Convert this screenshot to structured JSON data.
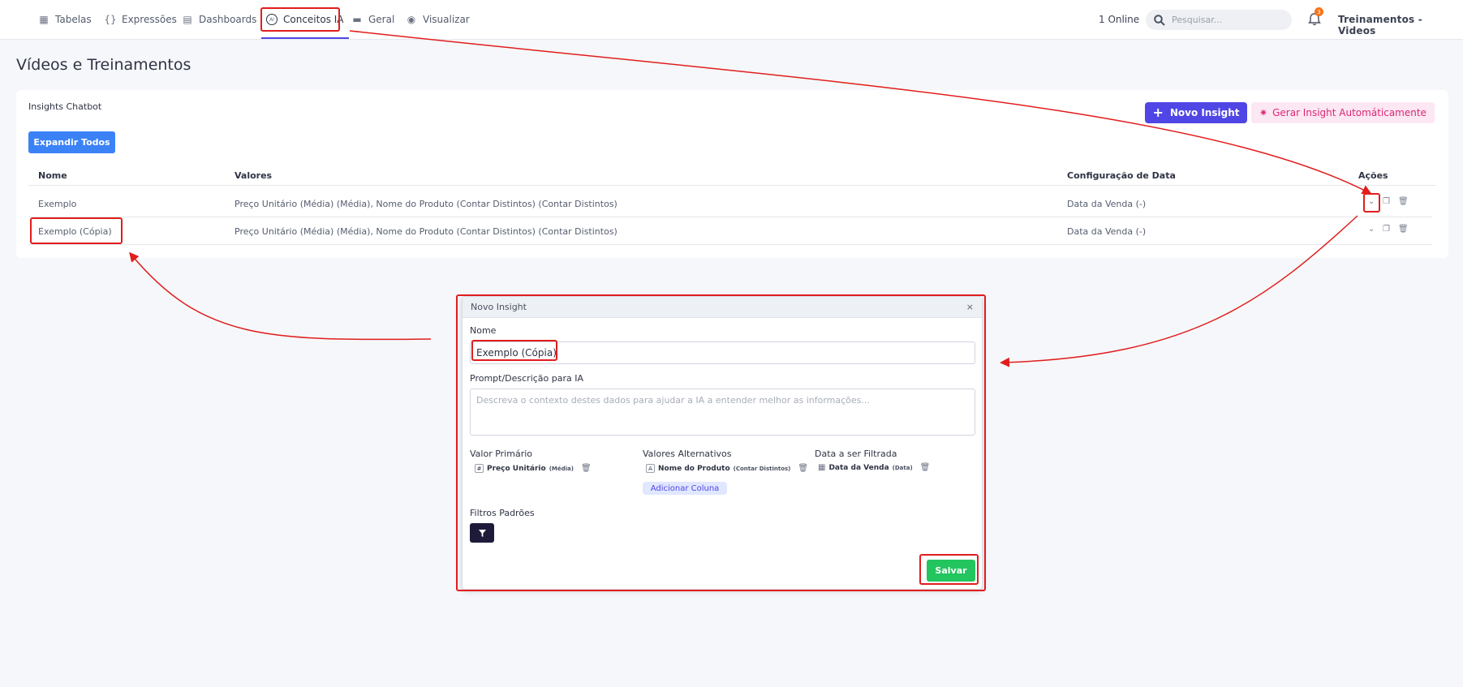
{
  "nav": {
    "items": [
      {
        "label": "Tabelas",
        "icon": "table-icon"
      },
      {
        "label": "Expressões",
        "icon": "braces-icon"
      },
      {
        "label": "Dashboards",
        "icon": "dashboard-icon"
      },
      {
        "label": "Conceitos IA",
        "icon": "ai-icon"
      },
      {
        "label": "Geral",
        "icon": "window-icon"
      },
      {
        "label": "Visualizar",
        "icon": "eye-icon"
      }
    ],
    "online": "1 Online",
    "search_placeholder": "Pesquisar...",
    "notification_count": "3",
    "user": "Treinamentos - Videos"
  },
  "page": {
    "title": "Vídeos e Treinamentos"
  },
  "card": {
    "label": "Insights Chatbot",
    "new_button": "Novo Insight",
    "auto_button": "Gerar Insight Automáticamente",
    "expand_button": "Expandir Todos",
    "columns": [
      "Nome",
      "Valores",
      "Configuração de Data",
      "Ações"
    ],
    "rows": [
      {
        "name": "Exemplo",
        "values": "Preço Unitário (Média) (Média), Nome do Produto (Contar Distintos) (Contar Distintos)",
        "date": "Data da Venda (-)"
      },
      {
        "name": "Exemplo (Cópia)",
        "values": "Preço Unitário (Média) (Média), Nome do Produto (Contar Distintos) (Contar Distintos)",
        "date": "Data da Venda (-)"
      }
    ]
  },
  "modal": {
    "title": "Novo Insight",
    "close": "×",
    "name_label": "Nome",
    "name_value": "Exemplo (Cópia)",
    "prompt_label": "Prompt/Descrição para IA",
    "prompt_placeholder": "Descreva o contexto destes dados para ajudar a IA a entender melhor as informações...",
    "primary_label": "Valor Primário",
    "primary_type": "#",
    "primary_name": "Preço Unitário",
    "primary_agg": "(Média)",
    "alt_label": "Valores Alternativos",
    "alt_type": "A",
    "alt_name": "Nome do Produto",
    "alt_agg": "(Contar Distintos)",
    "add_column": "Adicionar Coluna",
    "date_label": "Data a ser Filtrada",
    "date_name": "Data da Venda",
    "date_agg": "(Data)",
    "filters_label": "Filtros Padrões",
    "save": "Salvar"
  },
  "colors": {
    "accent": "#4f46e5",
    "annotation": "#e11d1d",
    "save": "#22c55e"
  }
}
